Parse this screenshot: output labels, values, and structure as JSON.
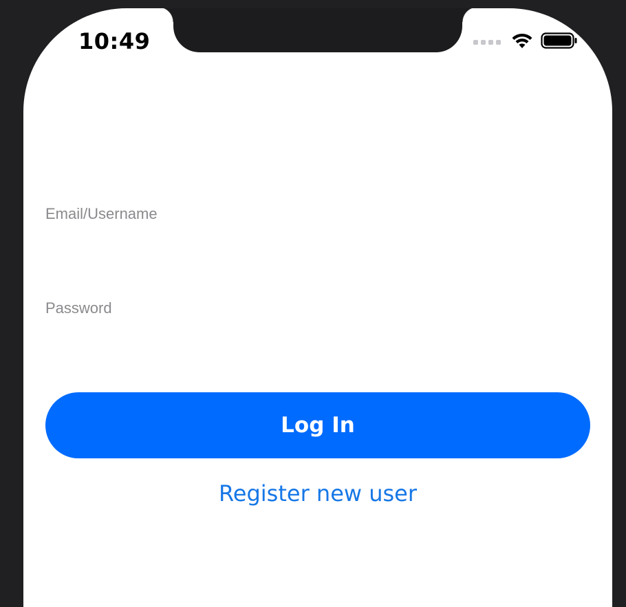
{
  "status_bar": {
    "time": "10:49",
    "icons": [
      "signal-dots-icon",
      "wifi-icon",
      "battery-icon"
    ]
  },
  "login_form": {
    "email_label": "Email/Username",
    "email_value": "",
    "password_label": "Password",
    "password_value": "",
    "login_button_label": "Log In",
    "register_link_label": "Register new user"
  },
  "colors": {
    "accent": "#006bff",
    "link": "#1677e6",
    "label": "#8a8a8e",
    "bezel": "#1c1c1e"
  }
}
